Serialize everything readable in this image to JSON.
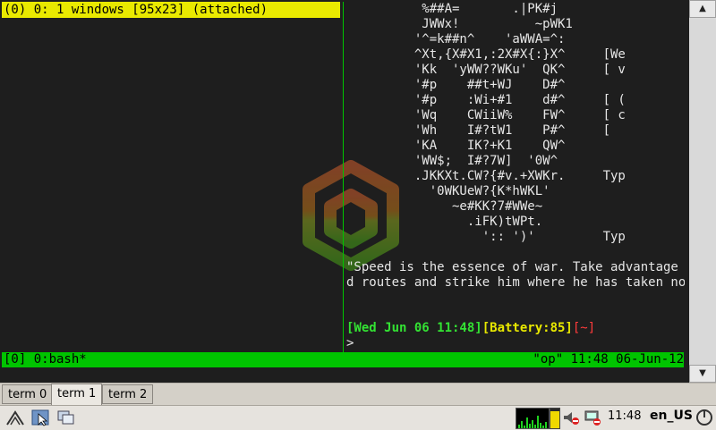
{
  "left_pane": {
    "header": "(0) 0: 1 windows [95x23] (attached)"
  },
  "right_pane": {
    "art_lines": [
      "          %##A=       .|PK#j      ",
      "          JWWx!          ~pWK1     ",
      "         '^=k##n^    'aWWA=^:      ",
      "         ^Xt,{X#X1,:2X#X{:}X^     [We",
      "         'Kk  'yWW??WKu'  QK^     [ v",
      "         '#p    ##t+WJ    D#^       ",
      "         '#p    :Wi+#1    d#^     [ (",
      "         'Wq    CWiiW%    FW^     [ c",
      "         'Wh    I#?tW1    P#^     [  ",
      "         'KA    IK?+K1    QW^       ",
      "         'WW$;  I#?7W]  '0W^        ",
      "         .JKKXt.CW?{#v.+XWKr.     Typ",
      "           '0WKUeW?{K*hWKL'        ",
      "              ~e#KK?7#WWe~         ",
      "                .iFK)tWPt.         ",
      "                  ':: ')'         Typ"
    ],
    "quote_lines": [
      "\"Speed is the essence of war. Take advantage of",
      "d routes and strike him where he has taken no p"
    ],
    "prompt": {
      "date": "[Wed Jun 06 11:48]",
      "battery": "[Battery:85]",
      "dir": "[~]",
      "caret": ">"
    }
  },
  "status_bar": {
    "left": "[0] 0:bash*",
    "right": "\"op\" 11:48 06-Jun-12"
  },
  "scrollbar": {
    "up_glyph": "▲",
    "down_glyph": "▼"
  },
  "tabs": [
    {
      "label": "term 0",
      "active": false
    },
    {
      "label": "term 1",
      "active": true
    },
    {
      "label": "term 2",
      "active": false
    }
  ],
  "panel": {
    "menu_icon": "start-menu-icon",
    "file_manager_icon": "file-manager-icon",
    "windows_icon": "show-desktop-icon",
    "cpu_graph_icon": "cpu-monitor-icon",
    "battery_level_percent": 85,
    "volume_icon": "volume-muted-icon",
    "network_icon": "network-icon",
    "clock": "11:48",
    "language": "en_US",
    "logout_icon": "logout-icon",
    "colors": {
      "status_green": "#00c400",
      "header_yellow": "#e9e900",
      "prompt_green": "#33e233",
      "prompt_yellow": "#e8e800",
      "prompt_red": "#ff3b3b"
    }
  }
}
